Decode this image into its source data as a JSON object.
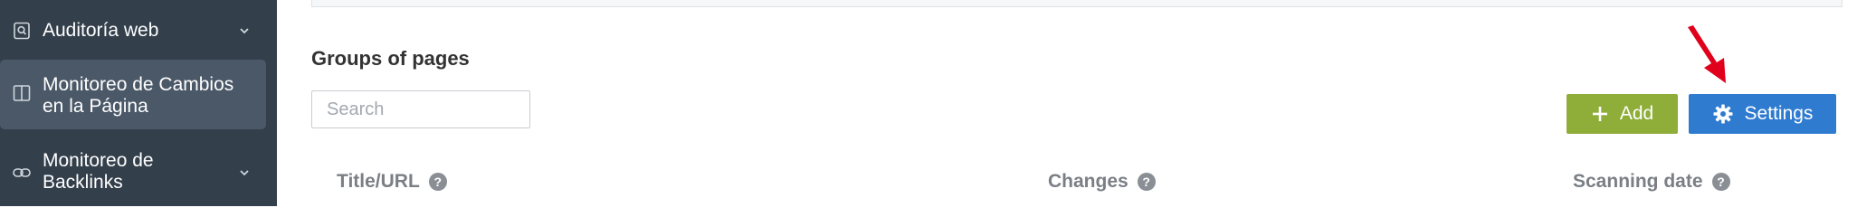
{
  "sidebar": {
    "items": [
      {
        "label": "Auditoría web",
        "icon": "search-document-icon",
        "has_chevron": true
      },
      {
        "label": "Monitoreo de Cambios en la Página",
        "icon": "book-icon",
        "active": true
      },
      {
        "label": "Monitoreo de Backlinks",
        "icon": "link-icon",
        "has_chevron": true
      }
    ]
  },
  "main": {
    "title": "Groups of pages",
    "search": {
      "placeholder": "Search",
      "value": ""
    },
    "buttons": {
      "add_label": "Add",
      "settings_label": "Settings"
    },
    "table": {
      "columns": [
        "Title/URL",
        "Changes",
        "Scanning date"
      ],
      "help_glyph": "?"
    }
  },
  "colors": {
    "sidebar_bg": "#333f4b",
    "sidebar_active_bg": "#4a5868",
    "add_button": "#8fad39",
    "settings_button": "#2f7bd0",
    "annotation_arrow": "#e0001b"
  }
}
